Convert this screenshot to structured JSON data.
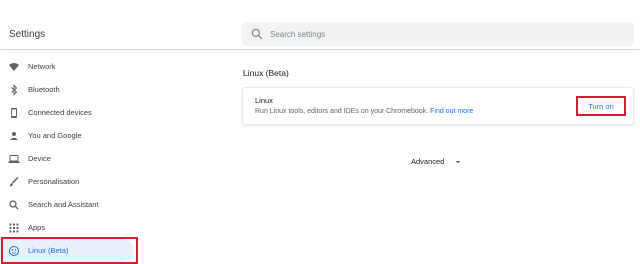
{
  "header": {
    "title": "Settings",
    "search_placeholder": "Search settings"
  },
  "sidebar": {
    "items": [
      {
        "label": "Network",
        "icon": "wifi-icon"
      },
      {
        "label": "Bluetooth",
        "icon": "bluetooth-icon"
      },
      {
        "label": "Connected devices",
        "icon": "phone-icon"
      },
      {
        "label": "You and Google",
        "icon": "person-icon"
      },
      {
        "label": "Device",
        "icon": "laptop-icon"
      },
      {
        "label": "Personalisation",
        "icon": "brush-icon"
      },
      {
        "label": "Search and Assistant",
        "icon": "search-icon"
      },
      {
        "label": "Apps",
        "icon": "apps-grid-icon"
      },
      {
        "label": "Linux (Beta)",
        "icon": "linux-icon",
        "active": true
      }
    ]
  },
  "main": {
    "section_title": "Linux (Beta)",
    "card": {
      "title": "Linux",
      "description": "Run Linux tools, editors and IDEs on your Chromebook.",
      "link": "Find out more",
      "button": "Turn on"
    },
    "advanced": "Advanced"
  },
  "colors": {
    "accent": "#1a73e8",
    "active_bg": "#e8f0fe",
    "highlight": "#d0202d"
  }
}
